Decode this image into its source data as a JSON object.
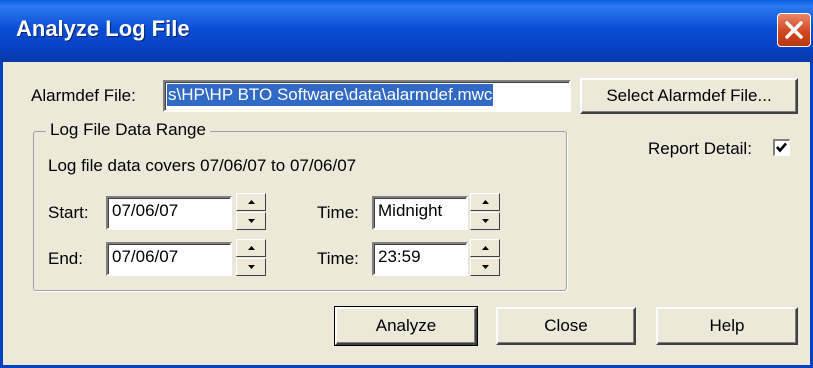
{
  "window": {
    "title": "Analyze Log File"
  },
  "alarmdef": {
    "label": "Alarmdef File:",
    "value": "s\\HP\\HP BTO Software\\data\\alarmdef.mwc",
    "select_button": "Select Alarmdef File..."
  },
  "range": {
    "group_title": "Log File Data Range",
    "covers_text": "Log file data covers 07/06/07 to 07/06/07",
    "start_label": "Start:",
    "start_value": "07/06/07",
    "start_time_label": "Time:",
    "start_time_value": "Midnight",
    "end_label": "End:",
    "end_value": "07/06/07",
    "end_time_label": "Time:",
    "end_time_value": "23:59"
  },
  "report_detail": {
    "label": "Report Detail:",
    "checked": true
  },
  "buttons": {
    "analyze": "Analyze",
    "close": "Close",
    "help": "Help"
  },
  "icons": {
    "close": "close-icon",
    "spin_up": "spin-up-icon",
    "spin_down": "spin-down-icon",
    "check": "check-icon"
  },
  "colors": {
    "titlebar": "#0840c2",
    "close_button": "#d2461f",
    "selection": "#316ac5",
    "face": "#ece9d8"
  }
}
